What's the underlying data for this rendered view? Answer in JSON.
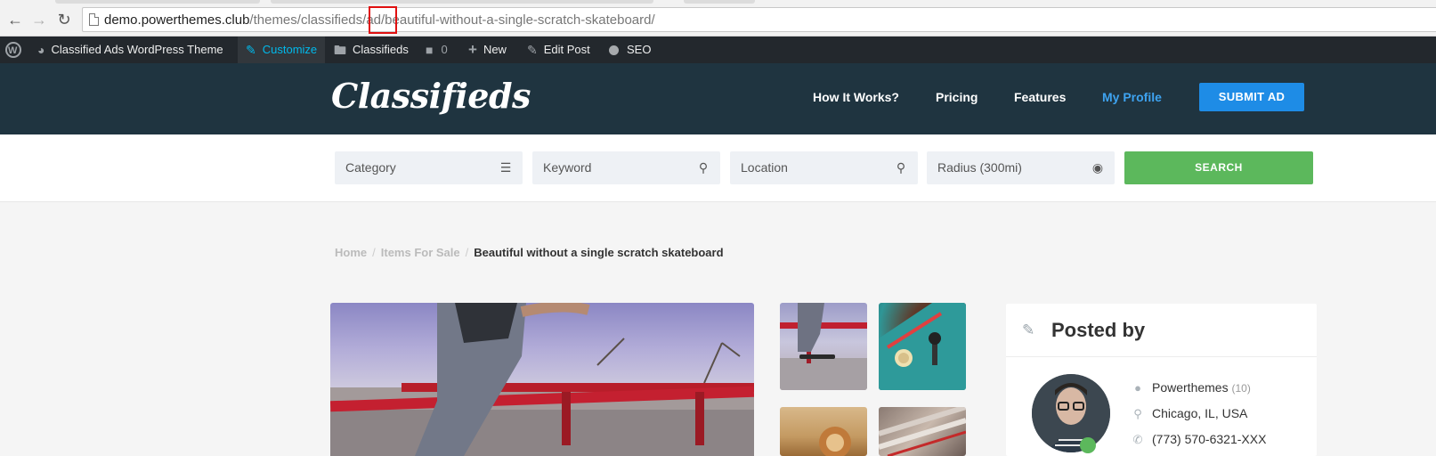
{
  "browser": {
    "url_host": "demo.powerthemes.club",
    "url_path_1": "/themes/classifieds/",
    "url_highlight": "ad",
    "url_path_2": "/beautiful-without-a-single-scratch-skateboard/"
  },
  "adminbar": {
    "site_name": "Classified Ads WordPress Theme",
    "customize": "Customize",
    "classifieds": "Classifieds",
    "comments_count": "0",
    "new": "New",
    "edit_post": "Edit Post",
    "seo": "SEO"
  },
  "header": {
    "logo": "Classifieds",
    "nav": [
      "How It Works?",
      "Pricing",
      "Features",
      "My Profile"
    ],
    "submit": "SUBMIT AD"
  },
  "search": {
    "category": "Category",
    "keyword": "Keyword",
    "location": "Location",
    "radius": "Radius (300mi)",
    "button": "SEARCH"
  },
  "breadcrumb": {
    "home": "Home",
    "section": "Items For Sale",
    "current": "Beautiful without a single scratch skateboard"
  },
  "posted_by": {
    "title": "Posted by",
    "name": "Powerthemes",
    "count": "(10)",
    "location": "Chicago, IL, USA",
    "phone": "(773) 570-6321-XXX"
  }
}
